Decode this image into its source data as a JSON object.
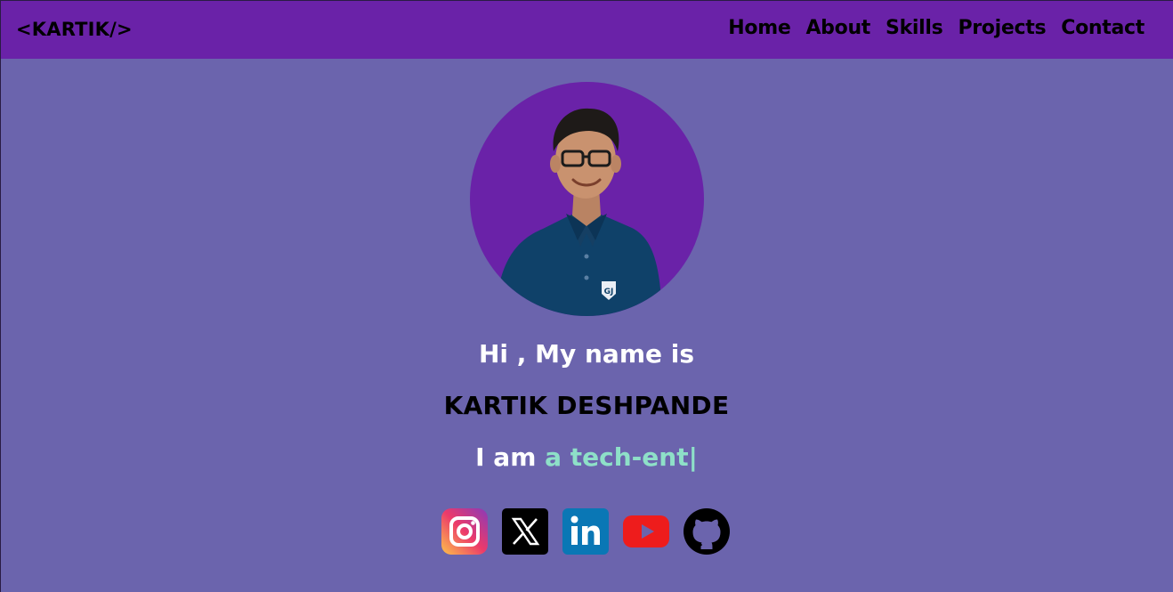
{
  "nav": {
    "logo": "<KARTIK/>",
    "links": [
      "Home",
      "About",
      "Skills",
      "Projects",
      "Contact"
    ]
  },
  "hero": {
    "greeting": "Hi , My name is",
    "name": "KARTIK DESHPANDE",
    "role_prefix": "I am ",
    "role_typed": "a tech-ent|"
  },
  "socials": [
    {
      "name": "instagram-icon"
    },
    {
      "name": "x-twitter-icon"
    },
    {
      "name": "linkedin-icon"
    },
    {
      "name": "youtube-icon"
    },
    {
      "name": "github-icon"
    }
  ],
  "colors": {
    "navbar": "#6a22a8",
    "background": "#6b64ad",
    "accent": "#8ee0c8"
  }
}
